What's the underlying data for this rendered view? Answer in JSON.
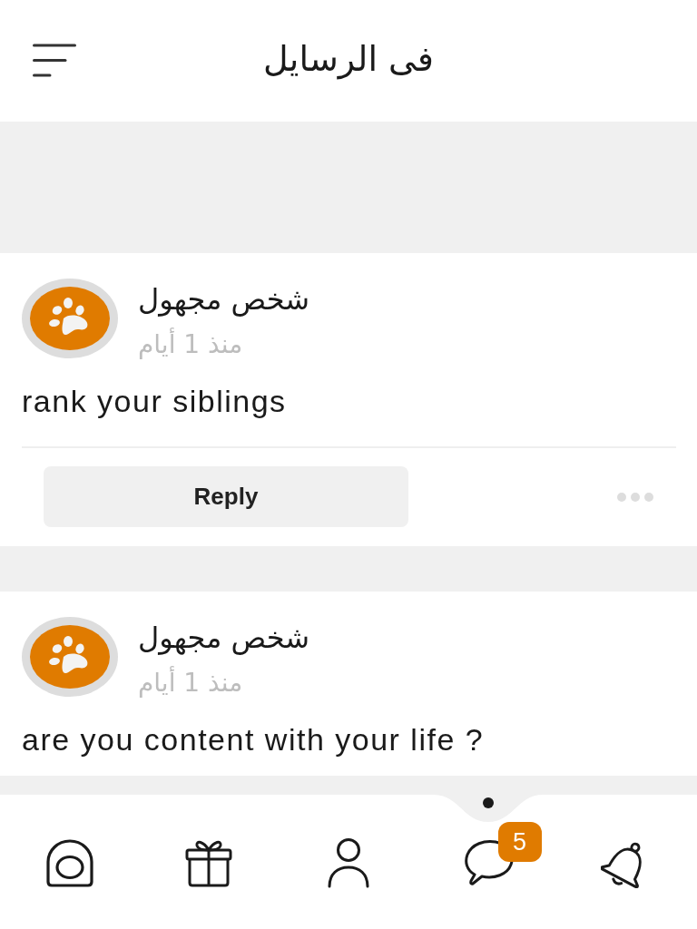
{
  "header": {
    "title": "فى الرسايل"
  },
  "posts": [
    {
      "author": "شخص مجهول",
      "time": "منذ 1 أيام",
      "text": "rank your siblings",
      "reply_label": "Reply"
    },
    {
      "author": "شخص مجهول",
      "time": "منذ 1 أيام",
      "text": "are you content with your life ?"
    }
  ],
  "nav": {
    "items": [
      {
        "selected": false
      },
      {
        "selected": false
      },
      {
        "selected": false
      },
      {
        "selected": true,
        "badge": "5"
      },
      {
        "selected": false
      }
    ]
  }
}
